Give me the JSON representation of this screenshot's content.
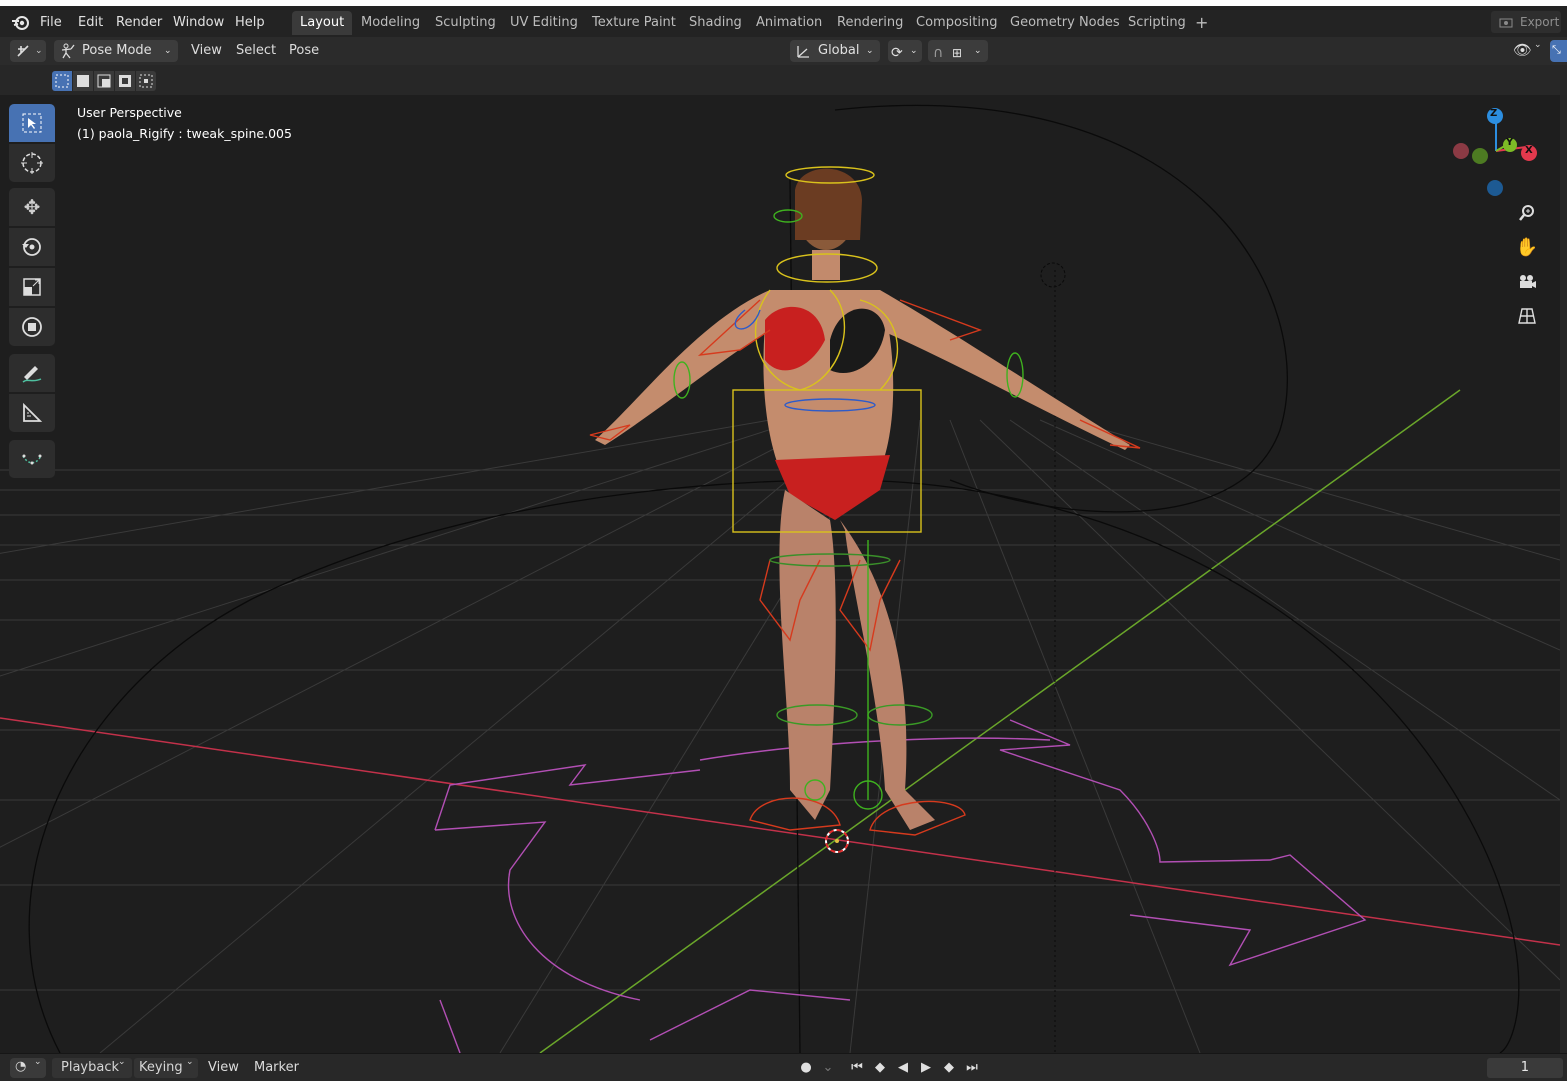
{
  "menu": {
    "file": "File",
    "edit": "Edit",
    "render": "Render",
    "window": "Window",
    "help": "Help"
  },
  "workspace_tabs": [
    {
      "label": "Layout",
      "active": true
    },
    {
      "label": "Modeling"
    },
    {
      "label": "Sculpting"
    },
    {
      "label": "UV Editing"
    },
    {
      "label": "Texture Paint"
    },
    {
      "label": "Shading"
    },
    {
      "label": "Animation"
    },
    {
      "label": "Rendering"
    },
    {
      "label": "Compositing"
    },
    {
      "label": "Geometry Nodes"
    },
    {
      "label": "Scripting"
    }
  ],
  "add_tab_symbol": "+",
  "export_label": "Export",
  "header": {
    "mode": "Pose Mode",
    "view": "View",
    "select": "Select",
    "pose": "Pose",
    "orientation": "Global"
  },
  "viewport": {
    "perspective": "User Perspective",
    "active_object": "(1) paola_Rigify : tweak_spine.005",
    "gizmo": {
      "x": "X",
      "y": "Y",
      "z": "Z"
    }
  },
  "toolbar_icons": [
    "select-box-icon",
    "cursor-icon",
    "move-icon",
    "rotate-icon",
    "scale-icon",
    "transform-icon",
    "annotate-icon",
    "measure-icon",
    "relax-icon"
  ],
  "timeline": {
    "playback": "Playback",
    "keying": "Keying",
    "view": "View",
    "marker": "Marker",
    "current_frame": "1"
  },
  "colors": {
    "accent": "#4772b3",
    "x_axis": "#e2394d",
    "y_axis": "#7dbb26",
    "z_axis": "#2c8ee0"
  }
}
